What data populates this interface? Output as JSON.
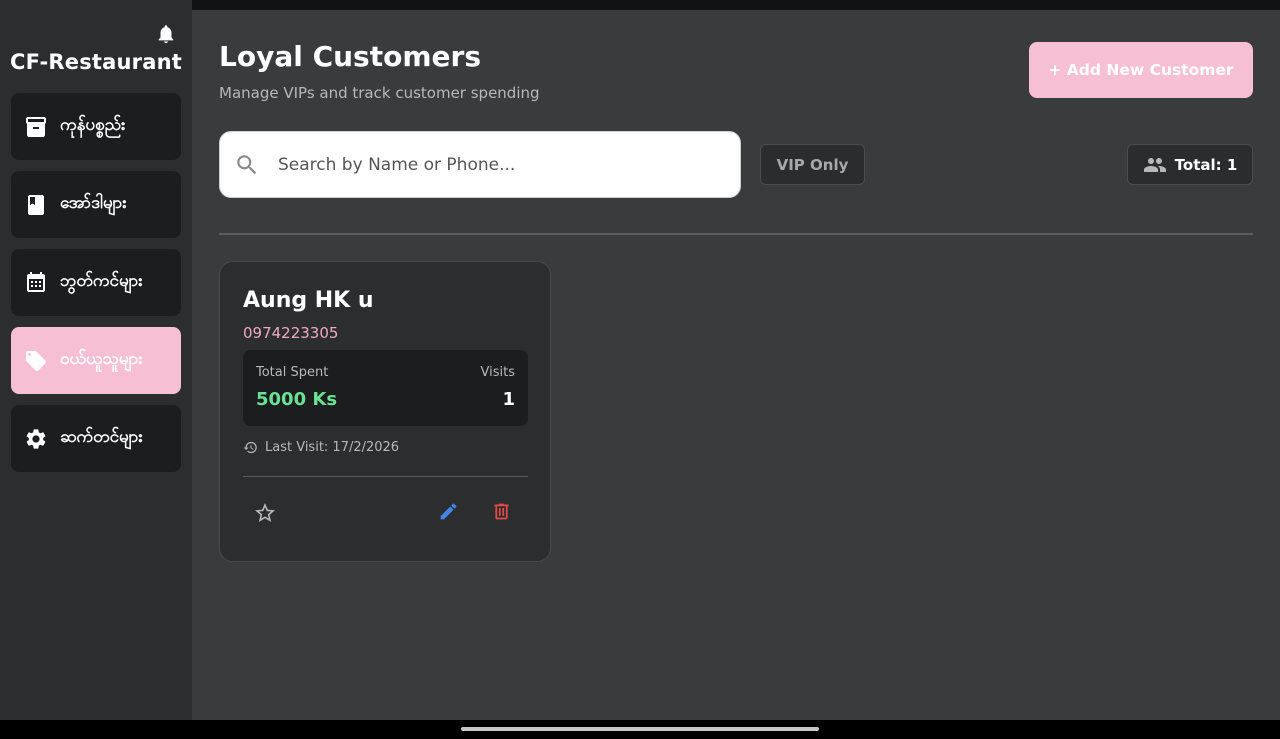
{
  "app": {
    "brand": "CF-Restaurant"
  },
  "sidebar": {
    "items": [
      {
        "label": "ကုန်ပစ္စည်း",
        "icon": "archive-icon",
        "active": false
      },
      {
        "label": "အော်ဒါများ",
        "icon": "book-icon",
        "active": false
      },
      {
        "label": "ဘွတ်ကင်များ",
        "icon": "calendar-icon",
        "active": false
      },
      {
        "label": "ဝယ်ယူသူများ",
        "icon": "tag-icon",
        "active": true
      },
      {
        "label": "ဆက်တင်များ",
        "icon": "gear-icon",
        "active": false
      }
    ]
  },
  "header": {
    "title": "Loyal Customers",
    "subtitle": "Manage VIPs and track customer spending",
    "add_button": "+ Add New Customer"
  },
  "filters": {
    "search_placeholder": "Search by Name or Phone...",
    "vip_label": "VIP Only",
    "total_label": "Total: 1"
  },
  "customers": [
    {
      "name": "Aung HK u",
      "phone": "0974223305",
      "total_spent_label": "Total Spent",
      "total_spent": "5000 Ks",
      "visits_label": "Visits",
      "visits": "1",
      "last_visit": "Last Visit: 17/2/2026"
    }
  ],
  "colors": {
    "accent": "#f7bfd3",
    "sidebar_bg": "#2b2d2f",
    "main_bg": "#393b3d",
    "spent_green": "#6be095",
    "edit_blue": "#3f86e8",
    "delete_red": "#e84a4a"
  }
}
